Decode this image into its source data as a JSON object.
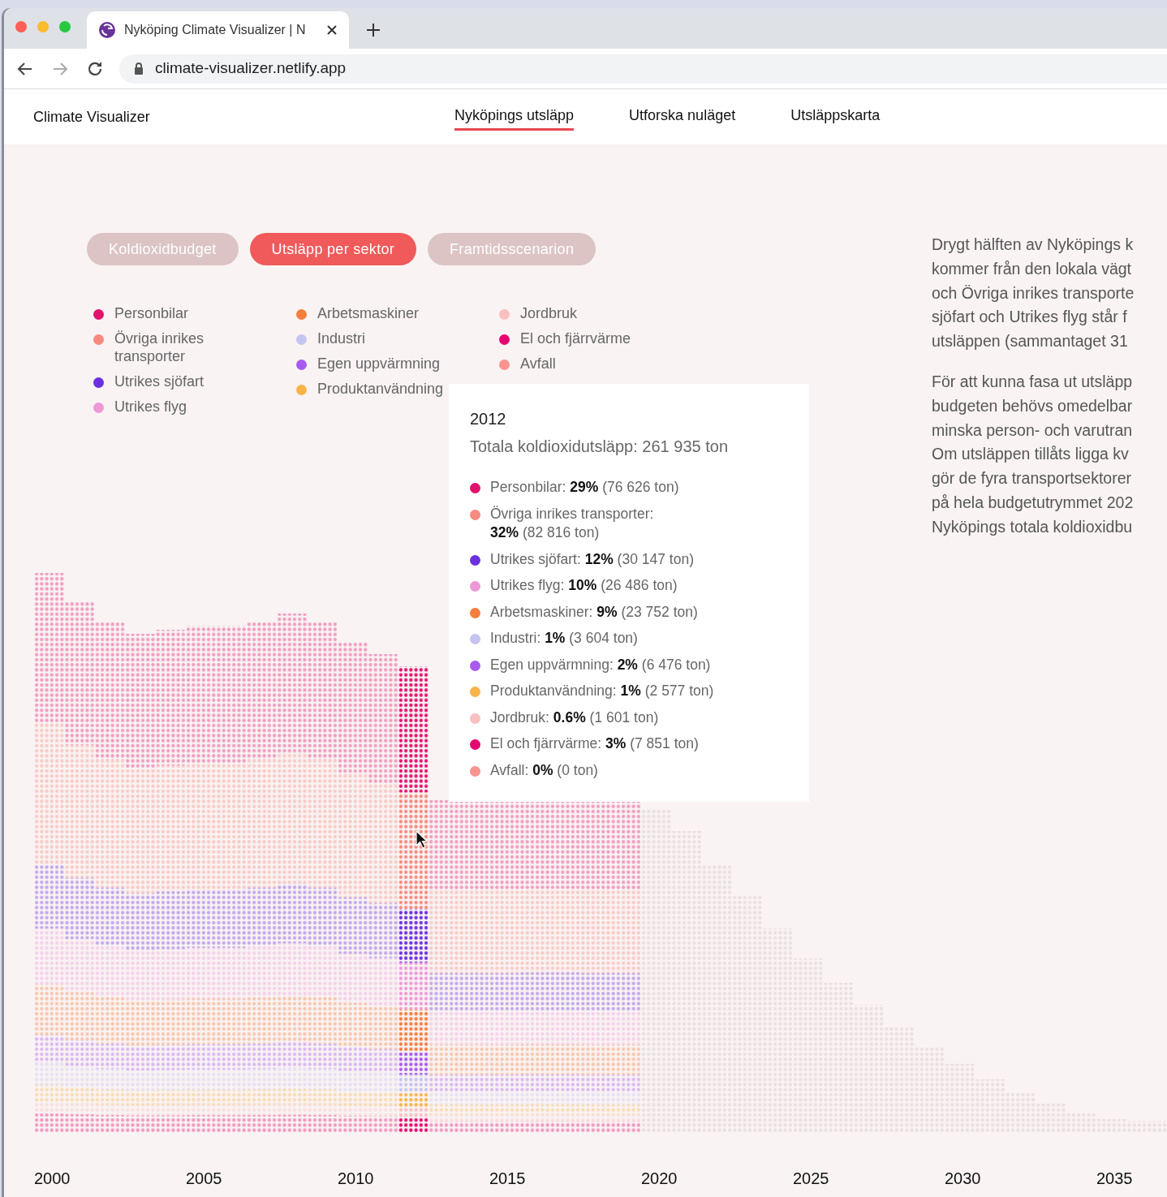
{
  "browser": {
    "tab_title": "Nyköping Climate Visualizer | N",
    "url": "climate-visualizer.netlify.app"
  },
  "nav": {
    "brand": "Climate Visualizer",
    "links": [
      {
        "label": "Nyköpings utsläpp",
        "selected": true
      },
      {
        "label": "Utforska nuläget",
        "selected": false
      },
      {
        "label": "Utsläppskarta",
        "selected": false
      }
    ]
  },
  "view_buttons": [
    {
      "label": "Koldioxidbudget",
      "selected": false
    },
    {
      "label": "Utsläpp per sektor",
      "selected": true
    },
    {
      "label": "Framtidsscenarion",
      "selected": false
    }
  ],
  "legend": [
    {
      "label": "Personbilar",
      "color": "#e2126f"
    },
    {
      "label": "Övriga inrikes transporter",
      "color": "#f7897f"
    },
    {
      "label": "Utrikes sjöfart",
      "color": "#6b2fe0"
    },
    {
      "label": "Utrikes flyg",
      "color": "#ee98d8"
    },
    {
      "label": "Arbetsmaskiner",
      "color": "#f57d3d"
    },
    {
      "label": "Industri",
      "color": "#c5c3f0"
    },
    {
      "label": "Egen uppvärmning",
      "color": "#a85af0"
    },
    {
      "label": "Produktanvändning",
      "color": "#f8b44b"
    },
    {
      "label": "Jordbruk",
      "color": "#f8c0c0"
    },
    {
      "label": "El och fjärrvärme",
      "color": "#e5066f"
    },
    {
      "label": "Avfall",
      "color": "#f8938e"
    }
  ],
  "description": [
    [
      "Drygt hälften av Nyköpings k",
      "kommer från den lokala vägt",
      "och Övriga inrikes transporte",
      "sjöfart och Utrikes flyg står f",
      "utsläppen (sammantaget 31"
    ],
    [
      "För att kunna fasa ut utsläpp",
      "budgeten behövs omedelbar",
      "minska person- och varutran",
      "Om utsläppen tillåts ligga kv",
      "gör de fyra transportsektorer",
      "på hela budgetutrymmet 202",
      "Nyköpings totala koldioxidbu"
    ]
  ],
  "tooltip": {
    "year": "2012",
    "total": "Totala koldioxidutsläpp: 261 935 ton",
    "items": [
      {
        "text": "Personbilar: **29%** (76 626 ton)",
        "color": "#e2126f"
      },
      {
        "text": "Övriga inrikes transporter: **32%** (82 816 ton)",
        "color": "#f7897f"
      },
      {
        "text": "Utrikes sjöfart: **12%** (30 147 ton)",
        "color": "#6b2fe0"
      },
      {
        "text": "Utrikes flyg: **10%** (26 486 ton)",
        "color": "#ee98d8"
      },
      {
        "text": "Arbetsmaskiner: **9%** (23 752 ton)",
        "color": "#f57d3d"
      },
      {
        "text": "Industri: **1%** (3 604 ton)",
        "color": "#c5c3f0"
      },
      {
        "text": "Egen uppvärmning: **2%** (6 476 ton)",
        "color": "#a85af0"
      },
      {
        "text": "Produktanvändning: **1%** (2 577 ton)",
        "color": "#f8b44b"
      },
      {
        "text": "Jordbruk: **0.6%** (1 601 ton)",
        "color": "#f8c0c0"
      },
      {
        "text": "El och fjärrvärme: **3%** (7 851 ton)",
        "color": "#e5066f"
      },
      {
        "text": "Avfall: **0%** (0 ton)",
        "color": "#f8938e"
      }
    ]
  },
  "x_axis_labels": [
    "2000",
    "2005",
    "2010",
    "2015",
    "2020",
    "2025",
    "2030",
    "2035"
  ]
}
